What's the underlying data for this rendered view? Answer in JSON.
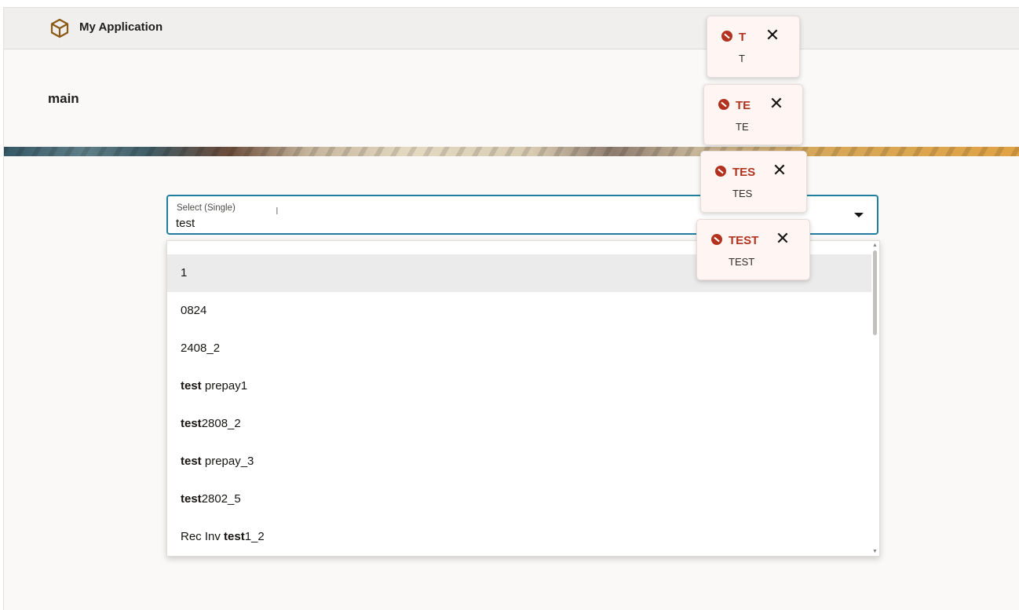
{
  "header": {
    "app_title": "My Application",
    "logo_icon": "cube-icon"
  },
  "page": {
    "title": "main"
  },
  "select": {
    "label": "Select (Single)",
    "value": "test",
    "caret_icon": "caret-down-icon",
    "options": [
      {
        "parts": [
          {
            "text": "1",
            "bold": false
          }
        ],
        "highlighted": true
      },
      {
        "parts": [
          {
            "text": "0824",
            "bold": false
          }
        ]
      },
      {
        "parts": [
          {
            "text": "2408_2",
            "bold": false
          }
        ]
      },
      {
        "parts": [
          {
            "text": "test",
            "bold": true
          },
          {
            "text": " prepay1",
            "bold": false
          }
        ]
      },
      {
        "parts": [
          {
            "text": "test",
            "bold": true
          },
          {
            "text": "2808_2",
            "bold": false
          }
        ]
      },
      {
        "parts": [
          {
            "text": "test",
            "bold": true
          },
          {
            "text": " prepay_3",
            "bold": false
          }
        ]
      },
      {
        "parts": [
          {
            "text": "test",
            "bold": true
          },
          {
            "text": "2802_5",
            "bold": false
          }
        ]
      },
      {
        "parts": [
          {
            "text": "Rec Inv ",
            "bold": false
          },
          {
            "text": "test",
            "bold": true
          },
          {
            "text": "1_2",
            "bold": false
          }
        ]
      }
    ]
  },
  "toasts": [
    {
      "title": "T",
      "message": "T",
      "icon": "error-icon",
      "close_icon": "close-icon"
    },
    {
      "title": "TE",
      "message": "TE",
      "icon": "error-icon",
      "close_icon": "close-icon"
    },
    {
      "title": "TES",
      "message": "TES",
      "icon": "error-icon",
      "close_icon": "close-icon"
    },
    {
      "title": "TEST",
      "message": "TEST",
      "icon": "error-icon",
      "close_icon": "close-icon"
    }
  ],
  "colors": {
    "accent": "#227e9e",
    "error": "#b3311f",
    "logo": "#8a5a14"
  }
}
